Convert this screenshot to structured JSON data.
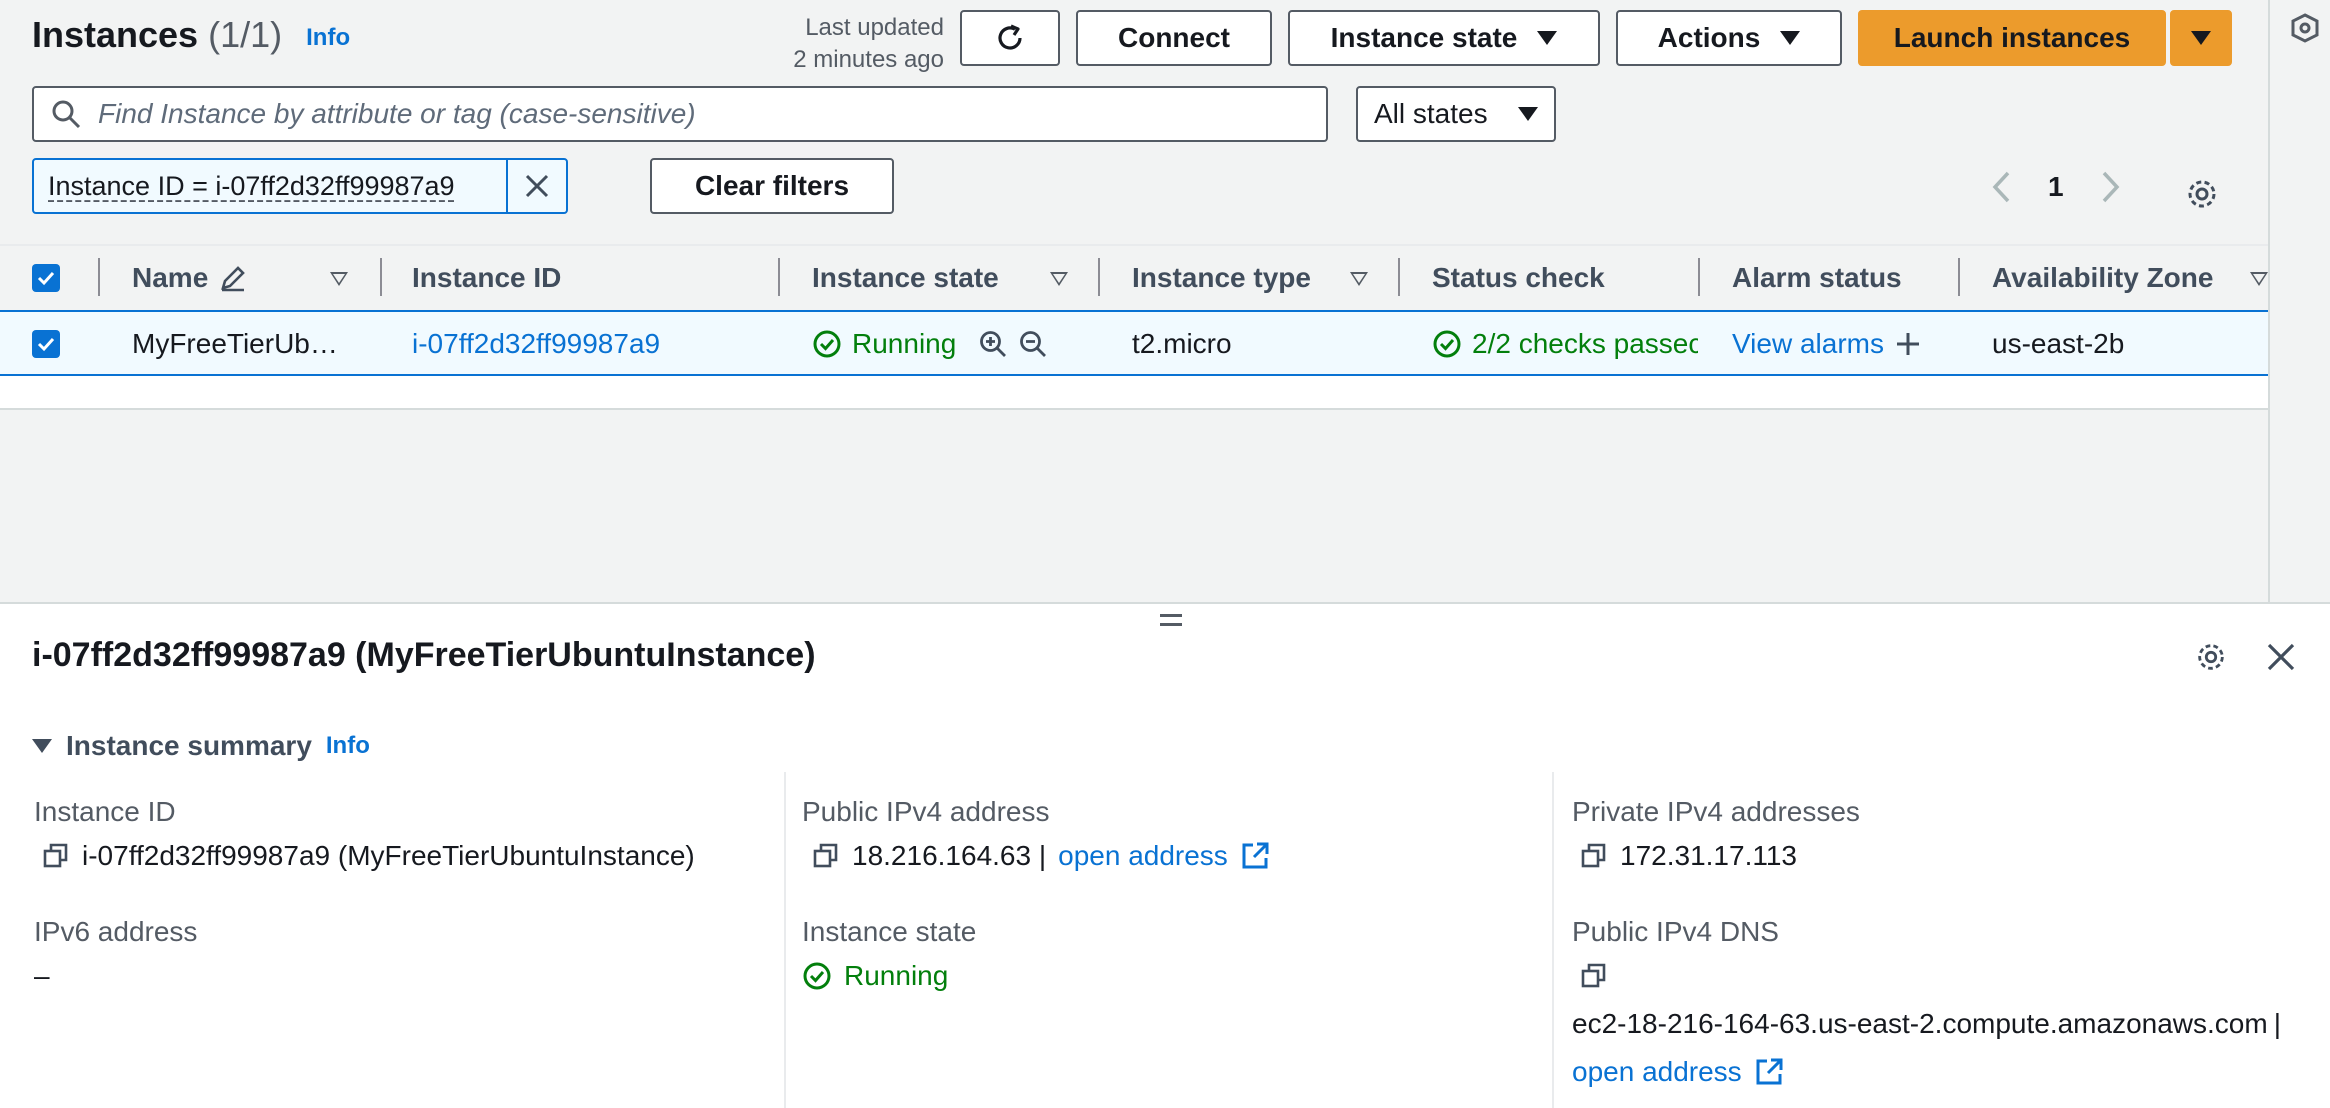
{
  "header": {
    "title": "Instances",
    "count": "(1/1)",
    "info": "Info",
    "last_updated_line1": "Last updated",
    "last_updated_line2": "2 minutes ago",
    "connect": "Connect",
    "instance_state": "Instance state",
    "actions": "Actions",
    "launch": "Launch instances"
  },
  "search": {
    "placeholder": "Find Instance by attribute or tag (case-sensitive)"
  },
  "state_filter": {
    "selected": "All states"
  },
  "filter_token": {
    "text": "Instance ID = i-07ff2d32ff99987a9"
  },
  "clear_filters": "Clear filters",
  "pagination": {
    "page": "1"
  },
  "table": {
    "columns": [
      "Name",
      "Instance ID",
      "Instance state",
      "Instance type",
      "Status check",
      "Alarm status",
      "Availability Zone"
    ],
    "rows": [
      {
        "name": "MyFreeTierUb…",
        "instance_id": "i-07ff2d32ff99987a9",
        "state": "Running",
        "type": "t2.micro",
        "status_check": "2/2 checks passec",
        "alarm": "View alarms",
        "az": "us-east-2b"
      }
    ]
  },
  "detail": {
    "title": "i-07ff2d32ff99987a9 (MyFreeTierUbuntuInstance)",
    "summary": "Instance summary",
    "info": "Info",
    "instance_id_label": "Instance ID",
    "instance_id_value": "i-07ff2d32ff99987a9 (MyFreeTierUbuntuInstance)",
    "ipv6_label": "IPv6 address",
    "ipv6_value": "–",
    "public_ipv4_label": "Public IPv4 address",
    "public_ipv4_value": "18.216.164.63 |",
    "open_address": "open address",
    "instance_state_label": "Instance state",
    "instance_state_value": "Running",
    "private_ipv4_label": "Private IPv4 addresses",
    "private_ipv4_value": "172.31.17.113",
    "public_dns_label": "Public IPv4 DNS",
    "public_dns_value": "ec2-18-216-164-63.us-east-2.compute.amazonaws.com",
    "public_dns_sep": "|",
    "public_dns_open": "open address"
  },
  "colors": {
    "accent": "#0972d3",
    "launch": "#ec9b2c",
    "success": "#037f0c"
  }
}
